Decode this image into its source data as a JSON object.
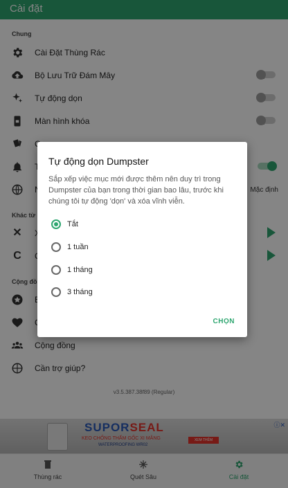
{
  "appbar": {
    "title": "Cài đặt"
  },
  "sections": {
    "general": "Chung",
    "other": "Khác từ D",
    "community": "Cộng đồn"
  },
  "settings": {
    "trash_settings": "Cài Đặt Thùng Rác",
    "cloud_storage": "Bộ Lưu Trữ Đám Mây",
    "auto_clean": "Tự động dọn",
    "lock_screen": "Màn hình khóa",
    "row5": "C",
    "row6": "T",
    "row7": "N",
    "language_value": "Mặc định",
    "other1": "X",
    "other2": "C",
    "comm1": "B",
    "comm2": "C",
    "community": "Cộng đồng",
    "help": "Cần trợ giúp?"
  },
  "version": "v3.5.387.38f89 (Regular)",
  "ad": {
    "brand_part1": "SUPOR",
    "brand_part2": "SEAL",
    "tagline": "KEO CHỐNG THẤM GỐC XI MĂNG",
    "subtagline": "WATERPROOFING WR02",
    "cta": "XEM THÊM",
    "close": "ⓘ✕"
  },
  "bottom_nav": {
    "trash": "Thùng rác",
    "scan": "Quét Sâu",
    "settings": "Cài đặt"
  },
  "dialog": {
    "title": "Tự động dọn Dumpster",
    "message": "Sắp xếp việc mục mới được thêm nên duy trì trong Dumpster của bạn trong thời gian bao lâu, trước khi chúng tôi tự động 'dọn' và xóa vĩnh viễn.",
    "options": [
      "Tắt",
      "1 tuần",
      "1 tháng",
      "3 tháng"
    ],
    "selected_option": "Tắt",
    "choose": "CHỌN"
  },
  "colors": {
    "accent": "#2ea670"
  }
}
